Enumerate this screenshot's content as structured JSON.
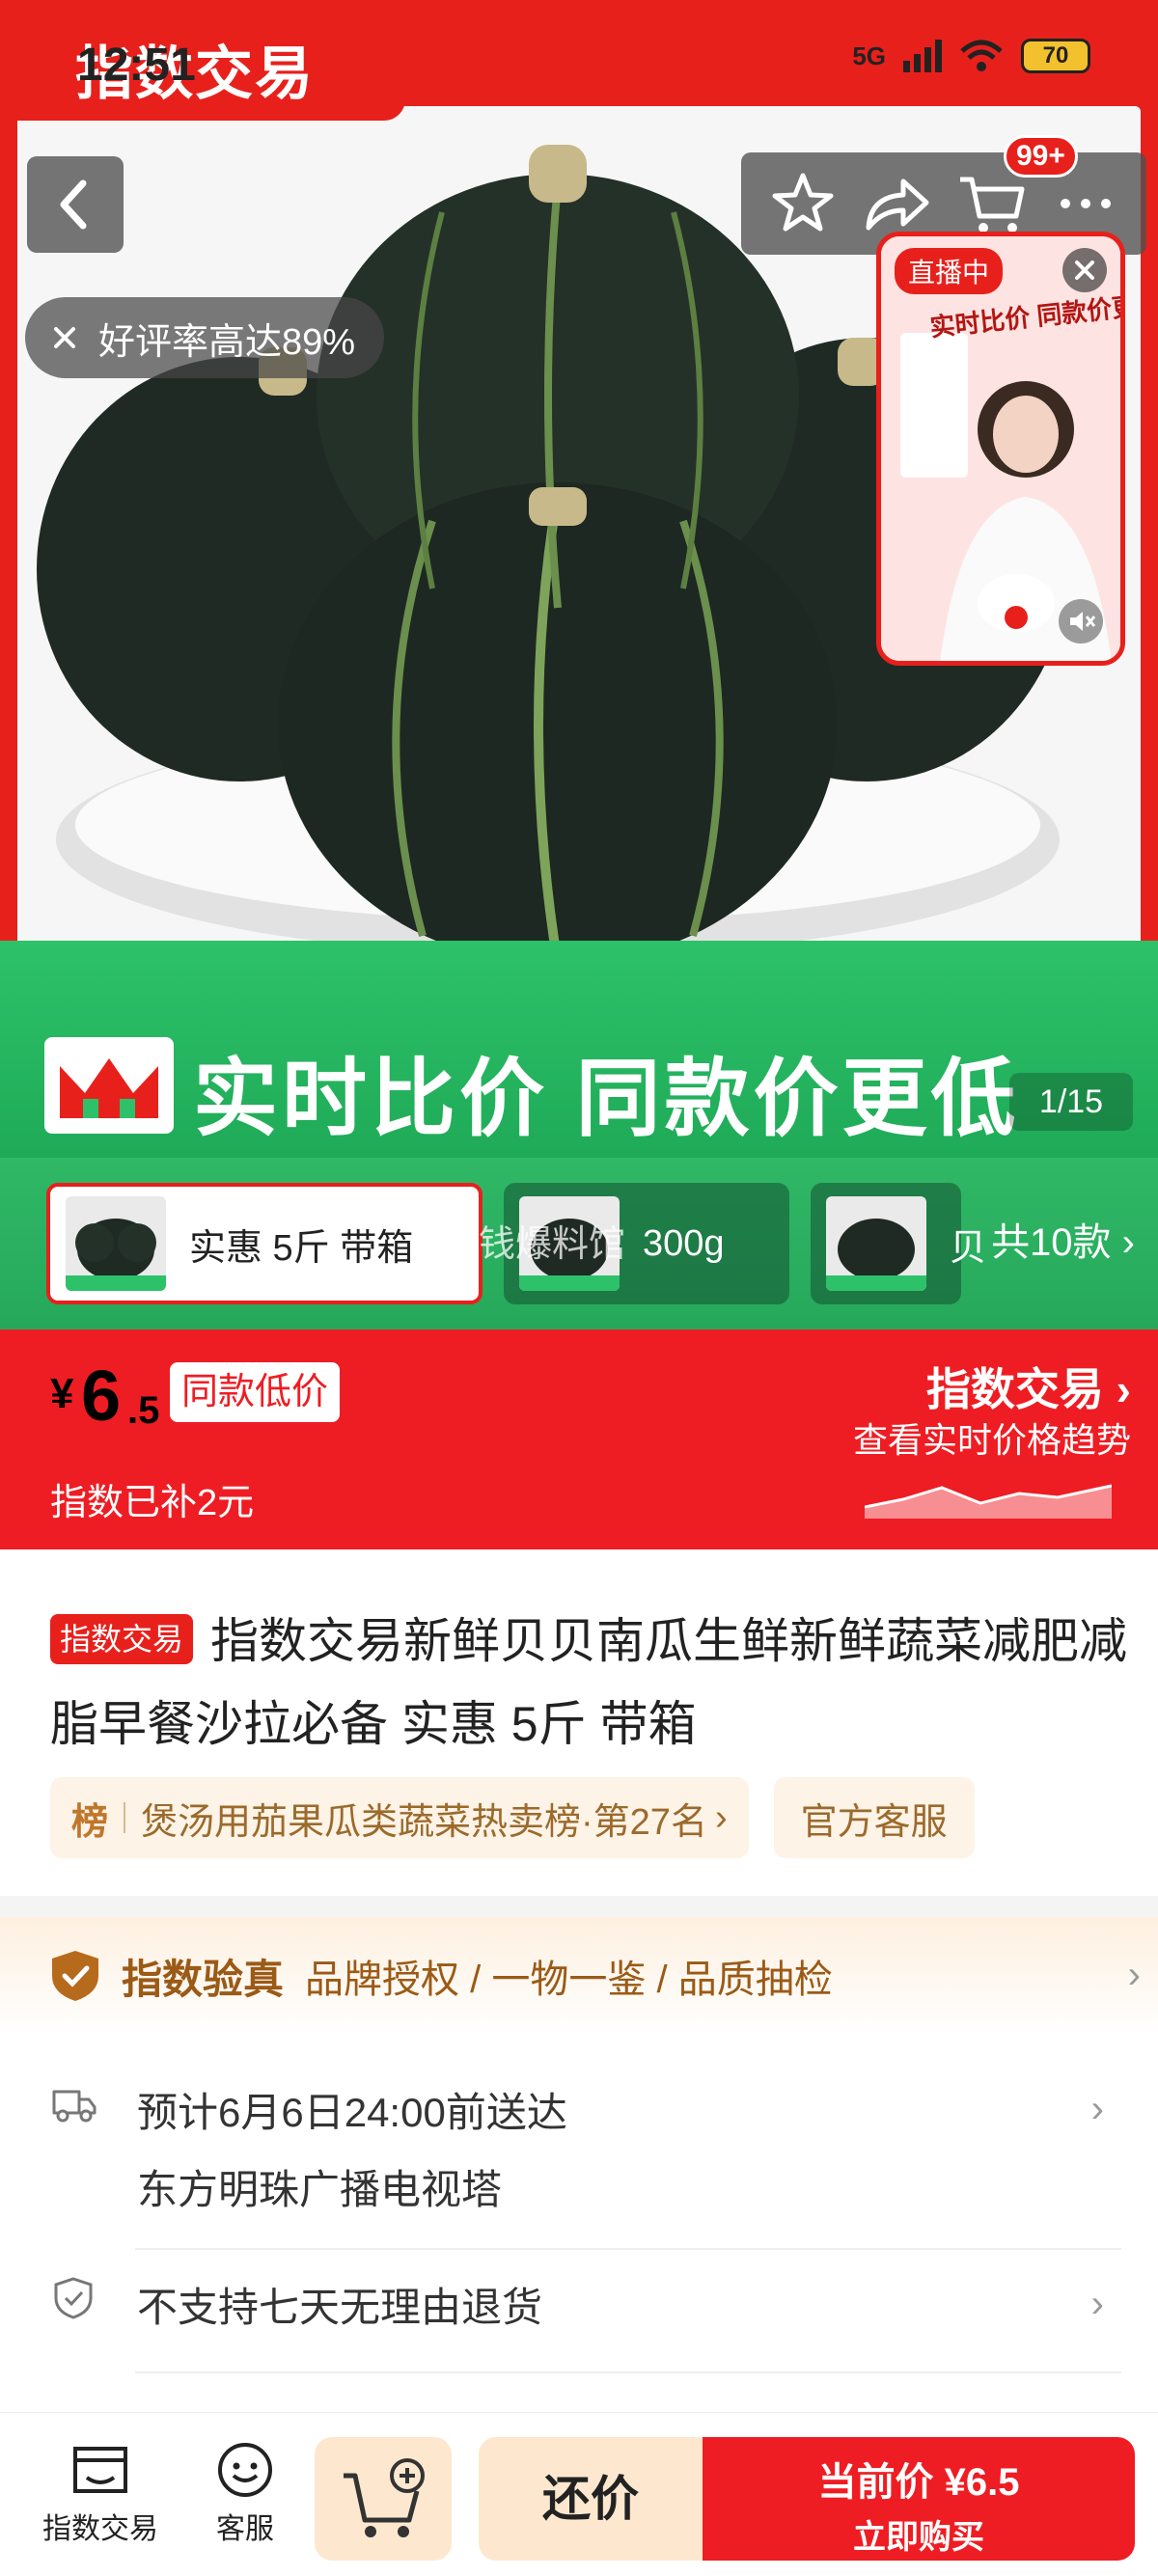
{
  "status_bar": {
    "time": "12:51",
    "network": "5G",
    "battery": "70"
  },
  "header": {
    "brand_tab": "指数交易",
    "cart_badge": "99+"
  },
  "hero": {
    "review_pill": "好评率高达89%",
    "live": {
      "tag": "直播中",
      "promo": "实时比价 同款价更低"
    },
    "banner_text": "实时比价 同款价更低",
    "page_indicator": "1/15"
  },
  "sku": {
    "items": [
      {
        "label": "实惠 5斤 带箱",
        "selected": true
      },
      {
        "label": "300g",
        "selected": false
      },
      {
        "label": "贝",
        "selected": false
      }
    ],
    "overlay_text": "省钱爆料馆",
    "more": "共10款"
  },
  "price": {
    "currency": "¥",
    "integer": "6",
    "decimal": ".5",
    "badge": "同款低价",
    "subsidy": "指数已补2元",
    "trend_title": "指数交易",
    "trend_sub": "查看实时价格趋势"
  },
  "product": {
    "badge": "指数交易",
    "title": "指数交易新鲜贝贝南瓜生鲜新鲜蔬菜减肥减脂早餐沙拉必备 实惠 5斤 带箱",
    "rank_prefix": "榜",
    "rank_text": "煲汤用茄果瓜类蔬菜热卖榜·第27名",
    "service_tag": "官方客服"
  },
  "verify": {
    "title": "指数验真",
    "desc": "品牌授权 / 一物一鉴 / 品质抽检"
  },
  "delivery": {
    "line1": "预计6月6日24:00前送达",
    "line2": "东方明珠广播电视塔"
  },
  "returns": {
    "text": "不支持七天无理由退货"
  },
  "bottom": {
    "store_label": "指数交易",
    "service_label": "客服",
    "bargain_label": "还价",
    "buy_line1": "当前价 ¥6.5",
    "buy_line2": "立即购买"
  },
  "colors": {
    "brand_red": "#ee1d23",
    "banner_green": "#2dc26a",
    "verify_brown": "#9b5a16"
  }
}
